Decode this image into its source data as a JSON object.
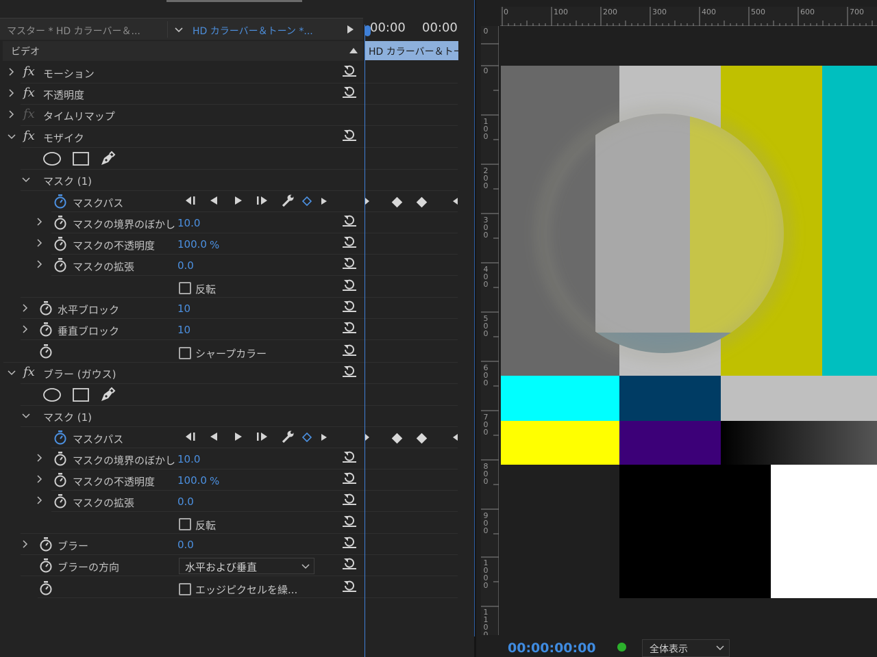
{
  "header": {
    "master_label": "マスター * HD カラーバー＆...",
    "clip_label": "HD カラーバー＆トーン *...",
    "timecode_left": "00:00",
    "timecode_right": "00:00",
    "timeline_clip": "HD カラーバー＆トーン"
  },
  "section": {
    "title": "ビデオ"
  },
  "effects": {
    "motion": "モーション",
    "opacity": "不透明度",
    "timeremap": "タイムリマップ",
    "mosaic": "モザイク",
    "blur": "ブラー (ガウス)"
  },
  "mosaic": {
    "mask": "マスク (1)",
    "maskpath": "マスクパス",
    "feather_label": "マスクの境界のぼかし",
    "feather_value": "10.0",
    "maskopacity_label": "マスクの不透明度",
    "maskopacity_value": "100.0",
    "percent": "%",
    "expansion_label": "マスクの拡張",
    "expansion_value": "0.0",
    "invert_label": "反転",
    "hblocks_label": "水平ブロック",
    "hblocks_value": "10",
    "vblocks_label": "垂直ブロック",
    "vblocks_value": "10",
    "sharp_label": "シャープカラー"
  },
  "blur": {
    "mask": "マスク (1)",
    "maskpath": "マスクパス",
    "feather_label": "マスクの境界のぼかし",
    "feather_value": "10.0",
    "maskopacity_label": "マスクの不透明度",
    "maskopacity_value": "100.0",
    "percent": "%",
    "expansion_label": "マスクの拡張",
    "expansion_value": "0.0",
    "invert_label": "反転",
    "blurriness_label": "ブラー",
    "blurriness_value": "0.0",
    "direction_label": "ブラーの方向",
    "direction_value": "水平および垂直",
    "edge_label": "エッジピクセルを繰..."
  },
  "ruler": {
    "top": [
      "0",
      "100",
      "200",
      "300",
      "400",
      "500",
      "600",
      "700"
    ],
    "left": [
      "0",
      "100",
      "200",
      "300",
      "400",
      "500",
      "600",
      "700",
      "800",
      "900",
      "1000",
      "1100"
    ],
    "left_top": "0"
  },
  "program": {
    "timecode": "00:00:00:00",
    "fit": "全体表示"
  },
  "colors": {
    "accent_blue": "#4c91e2",
    "playhead": "#3f80d8",
    "clip_bar": "#8db0dc"
  }
}
